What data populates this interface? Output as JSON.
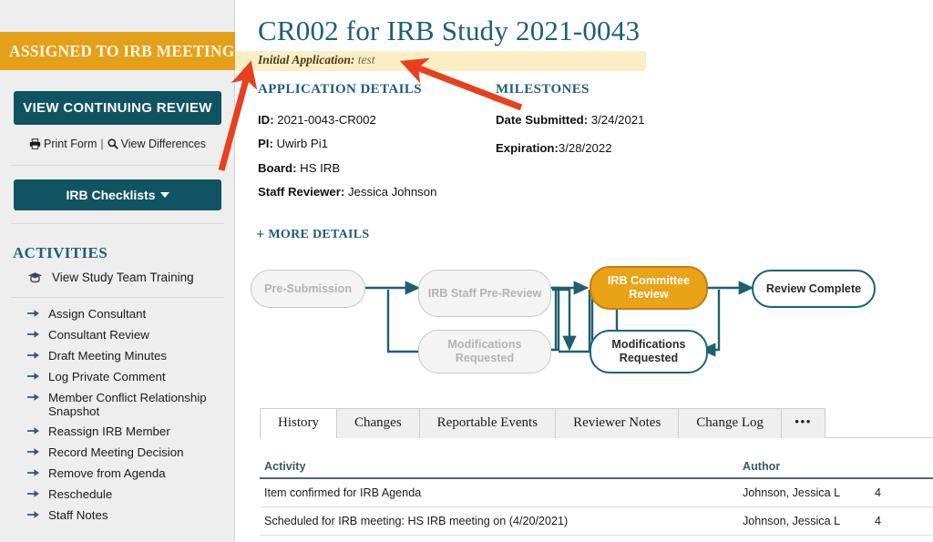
{
  "sidebar": {
    "status_banner": "ASSIGNED TO IRB MEETING",
    "primary_button": "VIEW CONTINUING REVIEW",
    "print_link": "Print Form",
    "separator": "|",
    "differences_link": "View Differences",
    "checklists_button": "IRB Checklists",
    "activities_heading": "ACTIVITIES",
    "training_item": "View Study Team Training",
    "activities": [
      "Assign Consultant",
      "Consultant Review",
      "Draft Meeting Minutes",
      "Log Private Comment",
      "Member Conflict Relationship Snapshot",
      "Reassign IRB Member",
      "Record Meeting Decision",
      "Remove from Agenda",
      "Reschedule",
      "Staff Notes"
    ]
  },
  "header": {
    "title": "CR002 for IRB Study 2021-0043",
    "subtitle_label": "Initial Application:",
    "subtitle_value": "test"
  },
  "application_details": {
    "heading": "APPLICATION DETAILS",
    "fields": [
      {
        "label": "ID:",
        "value": "2021-0043-CR002"
      },
      {
        "label": "PI:",
        "value": "Uwirb Pi1"
      },
      {
        "label": "Board:",
        "value": "HS IRB"
      },
      {
        "label": "Staff Reviewer:",
        "value": "Jessica Johnson"
      }
    ],
    "more_details": "MORE DETAILS"
  },
  "milestones": {
    "heading": "MILESTONES",
    "fields": [
      {
        "label": "Date Submitted:",
        "value": "3/24/2021"
      },
      {
        "label": "Expiration:",
        "value": "3/28/2022"
      }
    ]
  },
  "workflow": {
    "nodes": [
      {
        "label": "Pre-Submission",
        "state": "inactive"
      },
      {
        "label": "IRB Staff Pre-Review",
        "state": "inactive"
      },
      {
        "label": "Modifications Requested",
        "state": "inactive"
      },
      {
        "label": "IRB Committee Review",
        "state": "active"
      },
      {
        "label": "Modifications Requested",
        "state": "future"
      },
      {
        "label": "Review Complete",
        "state": "future"
      }
    ]
  },
  "tabs": [
    {
      "label": "History",
      "active": true
    },
    {
      "label": "Changes",
      "active": false
    },
    {
      "label": "Reportable Events",
      "active": false
    },
    {
      "label": "Reviewer Notes",
      "active": false
    },
    {
      "label": "Change Log",
      "active": false
    },
    {
      "label": "•••",
      "active": false
    }
  ],
  "history_table": {
    "columns": [
      "Activity",
      "Author",
      ""
    ],
    "rows": [
      {
        "activity": "Item confirmed for IRB Agenda",
        "author": "Johnson, Jessica L",
        "date": "4"
      },
      {
        "activity": "Scheduled for IRB meeting: HS IRB meeting on (4/20/2021)",
        "author": "Johnson, Jessica L",
        "date": "4"
      }
    ]
  },
  "colors": {
    "status_orange": "#e3a019",
    "teal_dark": "#105464",
    "heading_teal": "#1d6074",
    "highlight_yellow": "#fbeec4",
    "active_node_orange": "#e8a317",
    "annotation_red": "#e8401f"
  }
}
